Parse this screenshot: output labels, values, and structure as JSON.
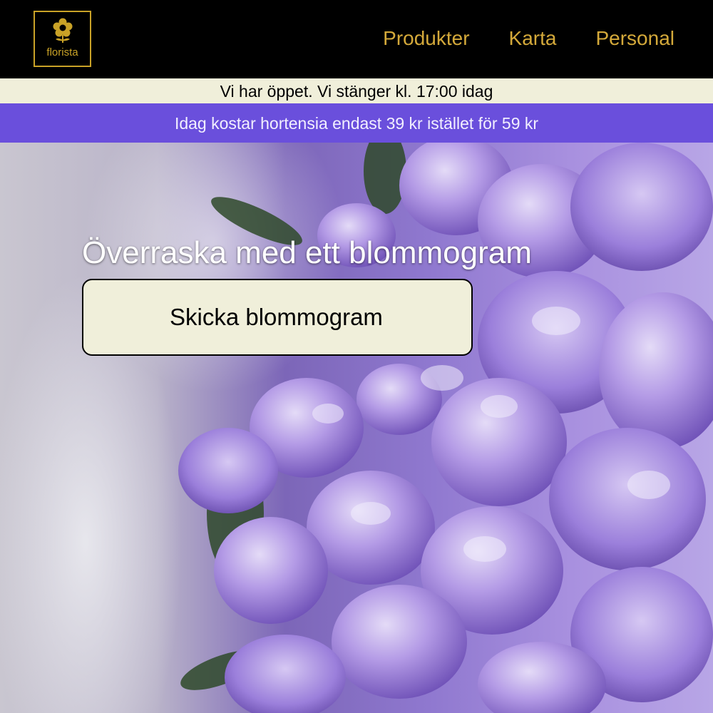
{
  "header": {
    "logo_text": "florista",
    "nav": [
      {
        "label": "Produkter"
      },
      {
        "label": "Karta"
      },
      {
        "label": "Personal"
      }
    ]
  },
  "status_bar": {
    "text": "Vi har öppet. Vi stänger kl. 17:00 idag"
  },
  "promo_bar": {
    "text": "Idag kostar hortensia endast 39 kr istället för 59 kr"
  },
  "hero": {
    "title": "Överraska med ett blommogram",
    "cta_label": "Skicka blommogram"
  },
  "colors": {
    "header_bg": "#000000",
    "accent_gold": "#d4a93a",
    "status_bg": "#f0efda",
    "promo_bg": "#6a4fdc",
    "button_bg": "#f0efda"
  },
  "icons": {
    "logo": "flower-icon"
  }
}
